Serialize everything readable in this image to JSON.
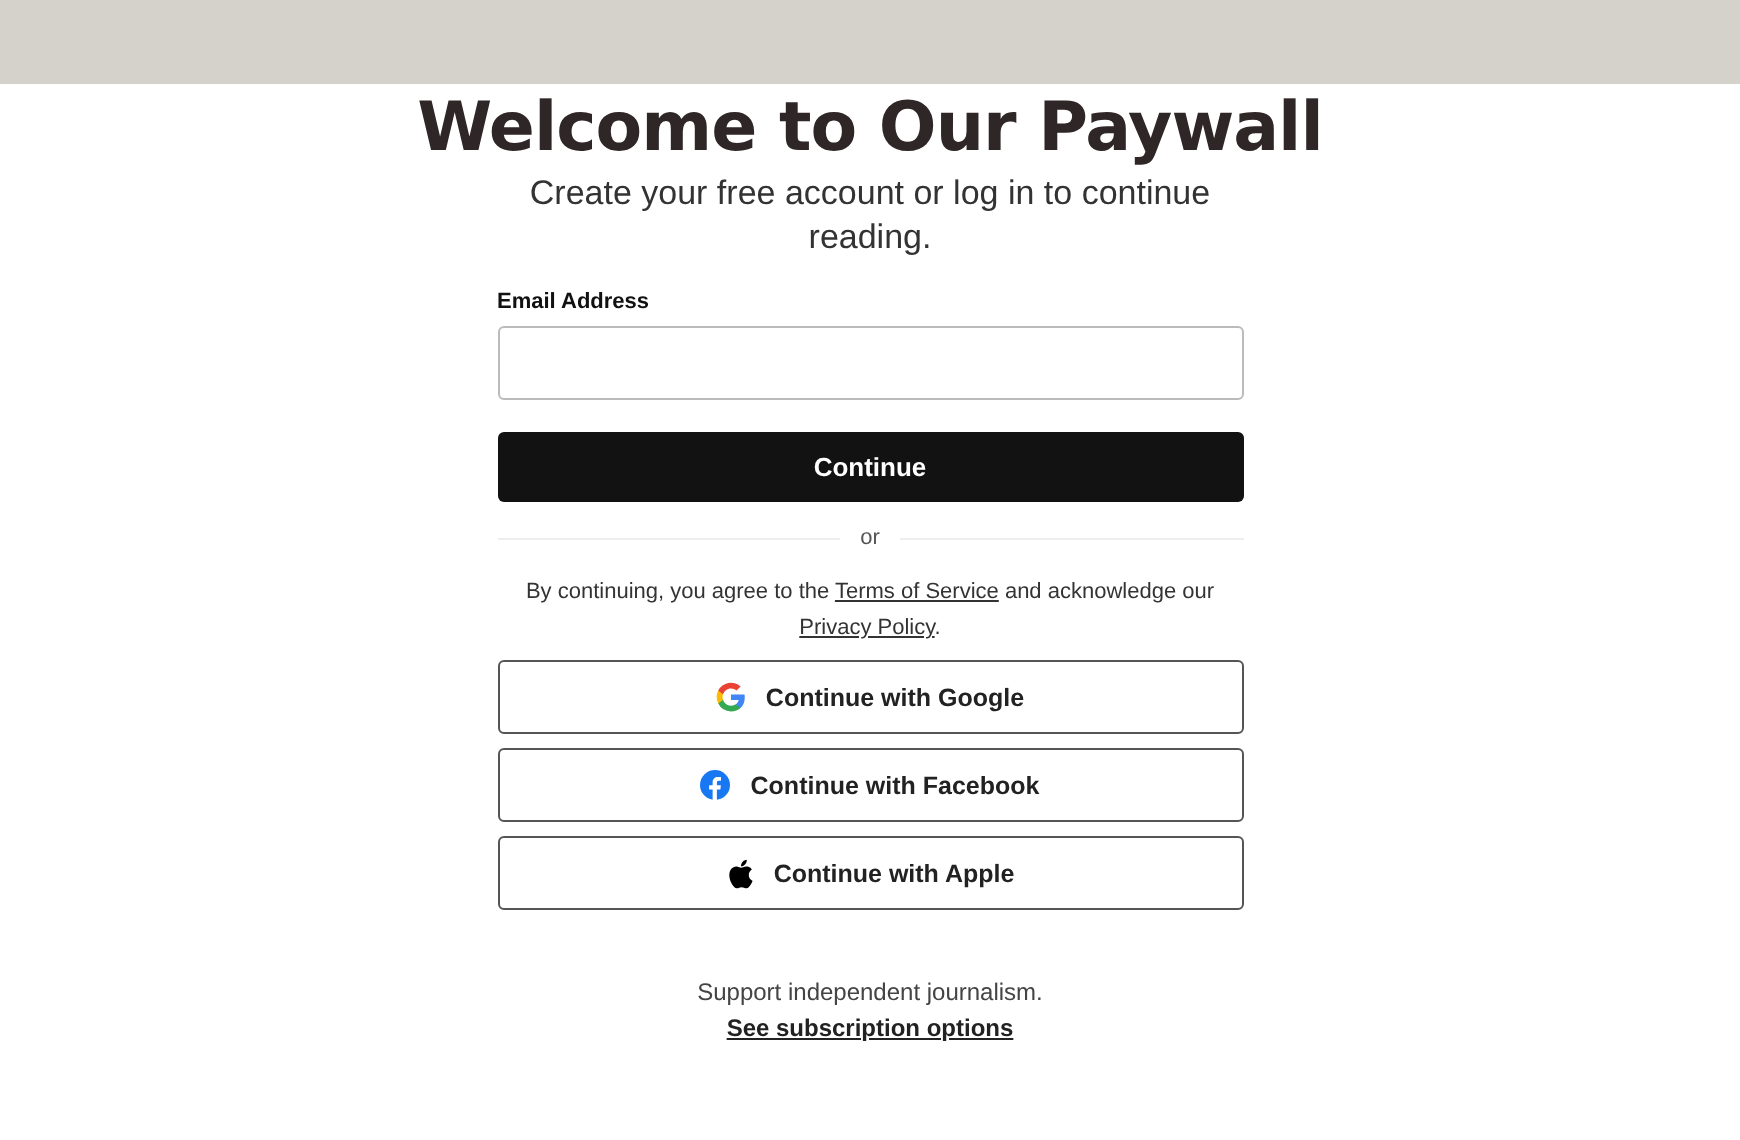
{
  "title": "Welcome to Our Paywall",
  "subtitle": "Create your free account or log in to continue reading.",
  "email": {
    "label": "Email Address"
  },
  "continue_button": "Continue",
  "divider": "or",
  "terms": {
    "before": "By continuing, you agree to the ",
    "terms_link": "Terms of Service",
    "middle": " and acknowledge our ",
    "privacy_link": "Privacy Policy",
    "after": "."
  },
  "social_buttons": [
    {
      "kind": "google",
      "label": "Continue with Google"
    },
    {
      "kind": "facebook",
      "label": "Continue with Facebook"
    },
    {
      "kind": "apple",
      "label": "Continue with Apple"
    }
  ],
  "footer": {
    "text": "Support independent journalism.",
    "link": "See subscription options"
  }
}
